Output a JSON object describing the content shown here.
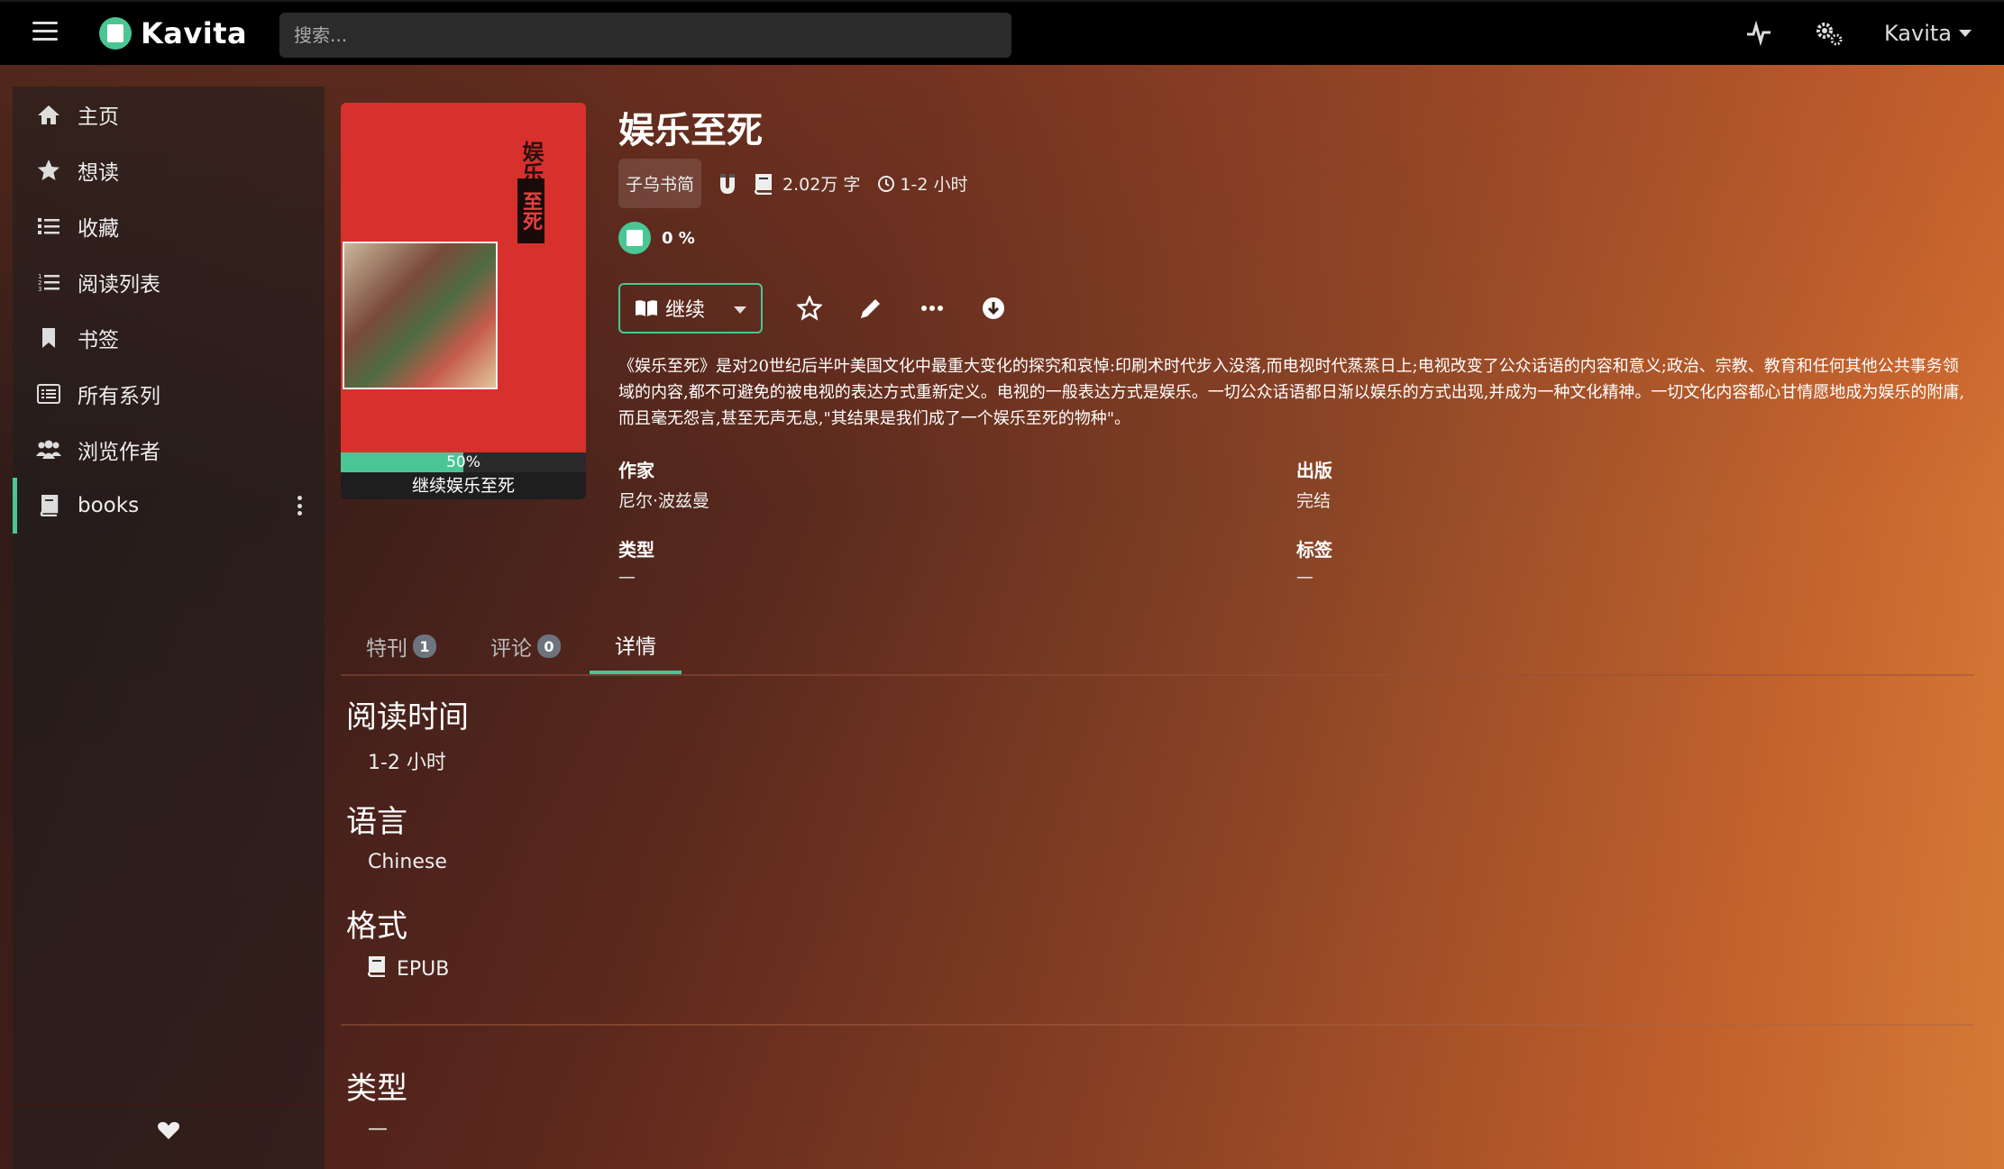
{
  "navbar": {
    "brand": "Kavita",
    "search_placeholder": "搜索...",
    "user": "Kavita"
  },
  "sidebar": {
    "items": [
      {
        "label": "主页",
        "icon": "home-icon"
      },
      {
        "label": "想读",
        "icon": "star-icon"
      },
      {
        "label": "收藏",
        "icon": "list-icon"
      },
      {
        "label": "阅读列表",
        "icon": "list-ol-icon"
      },
      {
        "label": "书签",
        "icon": "bookmark-icon"
      },
      {
        "label": "所有系列",
        "icon": "th-list-icon"
      },
      {
        "label": "浏览作者",
        "icon": "users-icon"
      },
      {
        "label": "books",
        "icon": "book-icon",
        "active": true
      }
    ]
  },
  "series": {
    "title": "娱乐至死",
    "publisher": "子乌书简",
    "word_count": "2.02万 字",
    "read_time": "1-2 小时",
    "progress_text": "0 %",
    "cover": {
      "title_chars": "娱乐",
      "title_chars_red": "至死",
      "progress_label": "50%",
      "progress_fraction": 0.5,
      "caption": "继续娱乐至死"
    },
    "continue_label": "继续",
    "summary": "《娱乐至死》是对20世纪后半叶美国文化中最重大变化的探究和哀悼:印刷术时代步入没落,而电视时代蒸蒸日上;电视改变了公众话语的内容和意义;政治、宗教、教育和任何其他公共事务领域的内容,都不可避免的被电视的表达方式重新定义。电视的一般表达方式是娱乐。一切公众话语都日渐以娱乐的方式出现,并成为一种文化精神。一切文化内容都心甘情愿地成为娱乐的附庸,而且毫无怨言,甚至无声无息,\"其结果是我们成了一个娱乐至死的物种\"。",
    "fields": {
      "author_label": "作家",
      "author_value": "尼尔·波兹曼",
      "publication_label": "出版",
      "publication_value": "完结",
      "genre_label": "类型",
      "genre_value": "—",
      "tags_label": "标签",
      "tags_value": "—"
    }
  },
  "tabs": [
    {
      "label": "特刊",
      "count": "1"
    },
    {
      "label": "评论",
      "count": "0"
    },
    {
      "label": "详情",
      "active": true
    }
  ],
  "details": {
    "reading_time_label": "阅读时间",
    "reading_time_value": "1-2 小时",
    "language_label": "语言",
    "language_value": "Chinese",
    "format_label": "格式",
    "format_value": "EPUB",
    "genre_label": "类型",
    "genre_value": "—"
  },
  "colors": {
    "accent": "#4ac694",
    "navbar": "#000000"
  }
}
